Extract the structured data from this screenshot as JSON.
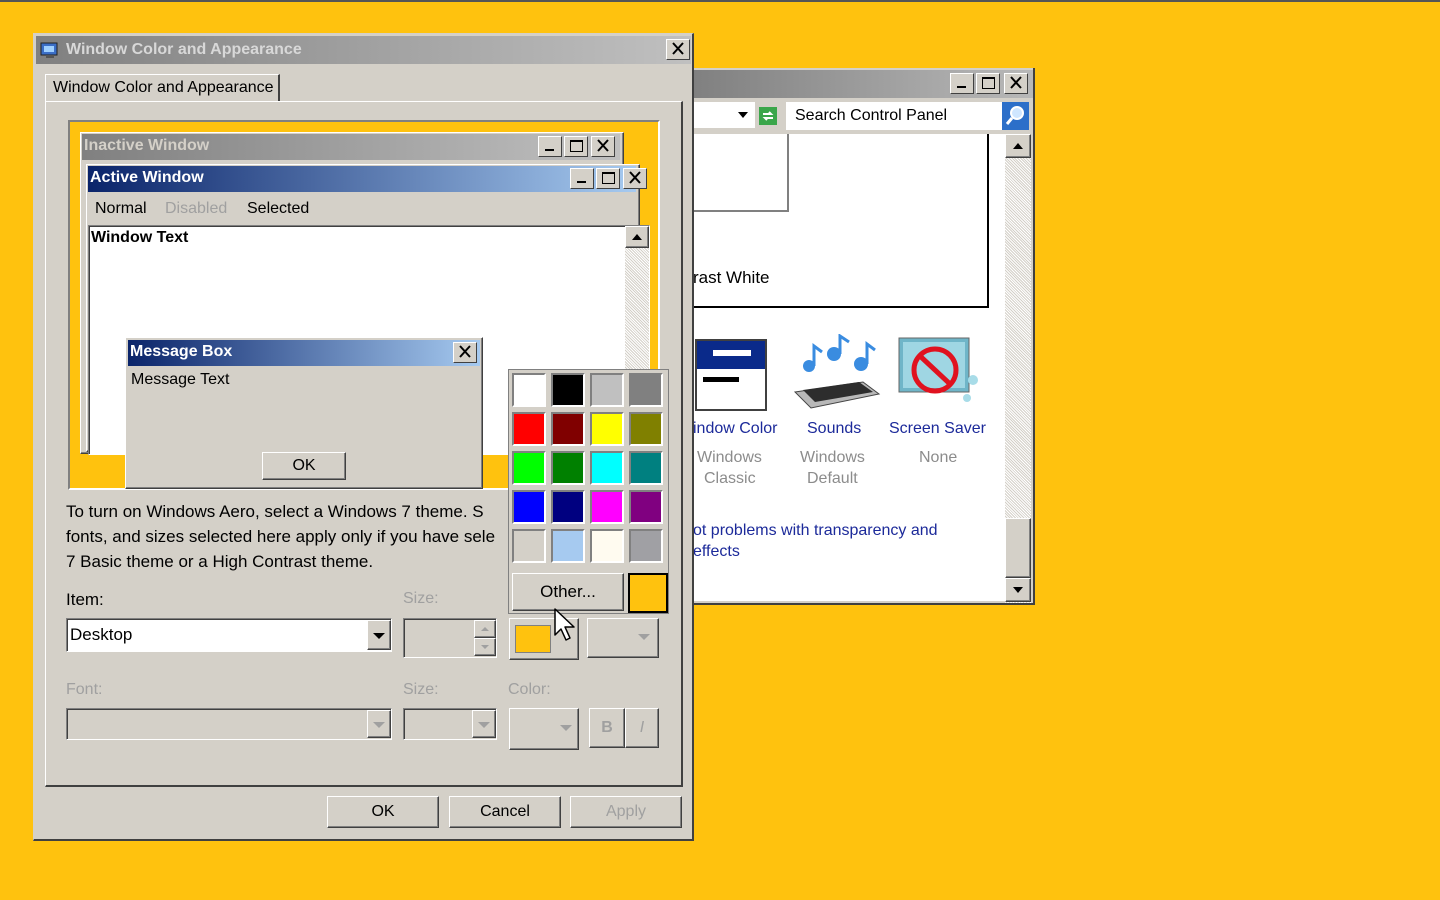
{
  "control_panel": {
    "search_placeholder": "Search Control Panel",
    "theme_name_partial": "rast White",
    "items": [
      {
        "label": "indow Color",
        "sub1": "Windows",
        "sub2": "Classic"
      },
      {
        "label": "Sounds",
        "sub1": "Windows",
        "sub2": "Default"
      },
      {
        "label": "Screen Saver",
        "sub1": "None",
        "sub2": ""
      }
    ],
    "link_line1": "ot problems with transparency and",
    "link_line2": "effects"
  },
  "dialog": {
    "title": "Window Color and Appearance",
    "tab_label": "Window Color and Appearance",
    "preview": {
      "inactive_title": "Inactive Window",
      "active_title": "Active Window",
      "menu_normal": "Normal",
      "menu_disabled": "Disabled",
      "menu_selected": "Selected",
      "window_text": "Window Text",
      "msgbox_title": "Message Box",
      "msgbox_text": "Message Text",
      "msgbox_ok": "OK"
    },
    "info_line1": "To turn on Windows Aero, select a Windows 7 theme.  S",
    "info_line2": "fonts, and sizes selected here apply only if you have sele",
    "info_line3": "7 Basic theme or a High Contrast theme.",
    "item_label": "Item:",
    "item_value": "Desktop",
    "size_label": "Size:",
    "font_label": "Font:",
    "font_size_label": "Size:",
    "color_label": "Color:",
    "bold_label": "B",
    "italic_label": "I",
    "ok_label": "OK",
    "cancel_label": "Cancel",
    "apply_label": "Apply",
    "selected_color": "#FFC20E"
  },
  "palette": {
    "colors": [
      "#FFFFFF",
      "#000000",
      "#C0C0C0",
      "#808080",
      "#FF0000",
      "#800000",
      "#FFFF00",
      "#808000",
      "#00FF00",
      "#008000",
      "#00FFFF",
      "#008080",
      "#0000FF",
      "#000080",
      "#FF00FF",
      "#800080",
      "#D4D0C8",
      "#A6CAF0",
      "#FFFBF0",
      "#A0A0A4"
    ],
    "other_label": "Other...",
    "current_color": "#FFC20E"
  },
  "desktop_color": "#FFC20E"
}
